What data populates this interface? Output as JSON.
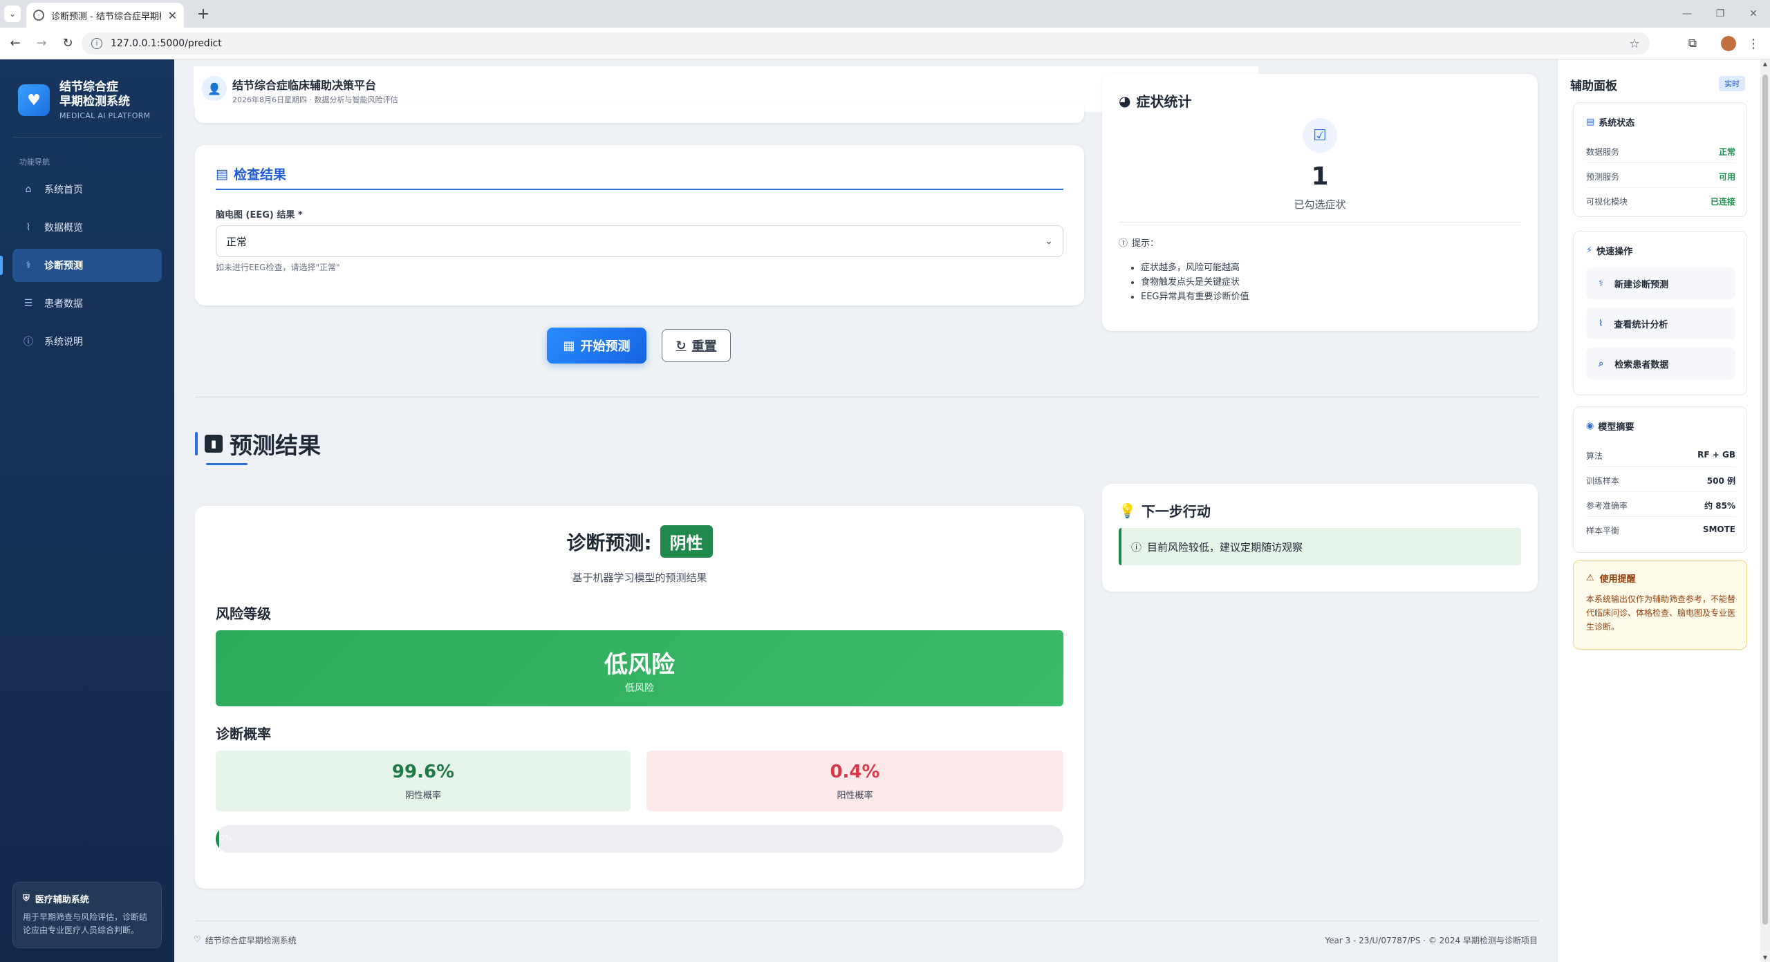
{
  "browser": {
    "tab_title": "诊断预测 - 结节综合症早期检测",
    "url": "127.0.0.1:5000/predict"
  },
  "sidebar": {
    "brand_title_line1": "结节综合症",
    "brand_title_line2": "早期检测系统",
    "brand_sub": "MEDICAL AI PLATFORM",
    "section_label": "功能导航",
    "items": [
      {
        "label": "系统首页",
        "icon": "home-icon"
      },
      {
        "label": "数据概览",
        "icon": "chart-line-icon"
      },
      {
        "label": "诊断预测",
        "icon": "stethoscope-icon",
        "active": true
      },
      {
        "label": "患者数据",
        "icon": "database-icon"
      },
      {
        "label": "系统说明",
        "icon": "info-icon"
      }
    ],
    "footer_title": "医疗辅助系统",
    "footer_text": "用于早期筛查与风险评估，诊断结论应由专业医疗人员综合判断。"
  },
  "header": {
    "title": "结节综合症临床辅助决策平台",
    "subtitle": "2026年8月6日星期四 · 数据分析与智能风险评估"
  },
  "exam": {
    "title": "检查结果",
    "field_label": "脑电图 (EEG) 结果 *",
    "select_value": "正常",
    "hint": "如未进行EEG检查，请选择\"正常\""
  },
  "actions": {
    "predict_label": "开始预测",
    "reset_label": "重置"
  },
  "result": {
    "section_title": "预测结果",
    "diag_label": "诊断预测:",
    "diag_value": "阴性",
    "diag_sub": "基于机器学习模型的预测结果",
    "risk_heading": "风险等级",
    "risk_main": "低风险",
    "risk_sub": "低风险",
    "prob_heading": "诊断概率",
    "neg_prob": "99.6%",
    "neg_label": "阴性概率",
    "pos_prob": "0.4%",
    "pos_label": "阳性概率",
    "positive_fraction": 0.004,
    "progress_text": "0%"
  },
  "stats": {
    "title": "症状统计",
    "count": "1",
    "count_label": "已勾选症状",
    "tips_head": "提示：",
    "tips": [
      "症状越多，风险可能越高",
      "食物触发点头是关键症状",
      "EEG异常具有重要诊断价值"
    ]
  },
  "next": {
    "title": "下一步行动",
    "message": "目前风险较低，建议定期随访观察"
  },
  "footer": {
    "left": "结节综合症早期检测系统",
    "right": "Year 3 - 23/U/07787/PS · © 2024 早期检测与诊断项目"
  },
  "assist": {
    "title": "辅助面板",
    "badge": "实时",
    "system_status": {
      "title": "系统状态",
      "rows": [
        {
          "key": "数据服务",
          "value": "正常"
        },
        {
          "key": "预测服务",
          "value": "可用"
        },
        {
          "key": "可视化模块",
          "value": "已连接"
        }
      ]
    },
    "quick": {
      "title": "快速操作",
      "items": [
        {
          "label": "新建诊断预测",
          "icon": "stethoscope-icon"
        },
        {
          "label": "查看统计分析",
          "icon": "chart-line-icon"
        },
        {
          "label": "检索患者数据",
          "icon": "search-icon"
        }
      ]
    },
    "model": {
      "title": "模型摘要",
      "rows": [
        {
          "key": "算法",
          "value": "RF + GB"
        },
        {
          "key": "训练样本",
          "value": "500 例"
        },
        {
          "key": "参考准确率",
          "value": "约 85%"
        },
        {
          "key": "样本平衡",
          "value": "SMOTE"
        }
      ]
    },
    "warning": {
      "title": "使用提醒",
      "text": "本系统输出仅作为辅助筛查参考，不能替代临床问诊、体格检查、脑电图及专业医生诊断。"
    }
  },
  "colors": {
    "sidebar_bg": "#17355d",
    "primary": "#1565e0",
    "negative_green": "#1f8a4c",
    "positive_red": "#d33a4a"
  }
}
